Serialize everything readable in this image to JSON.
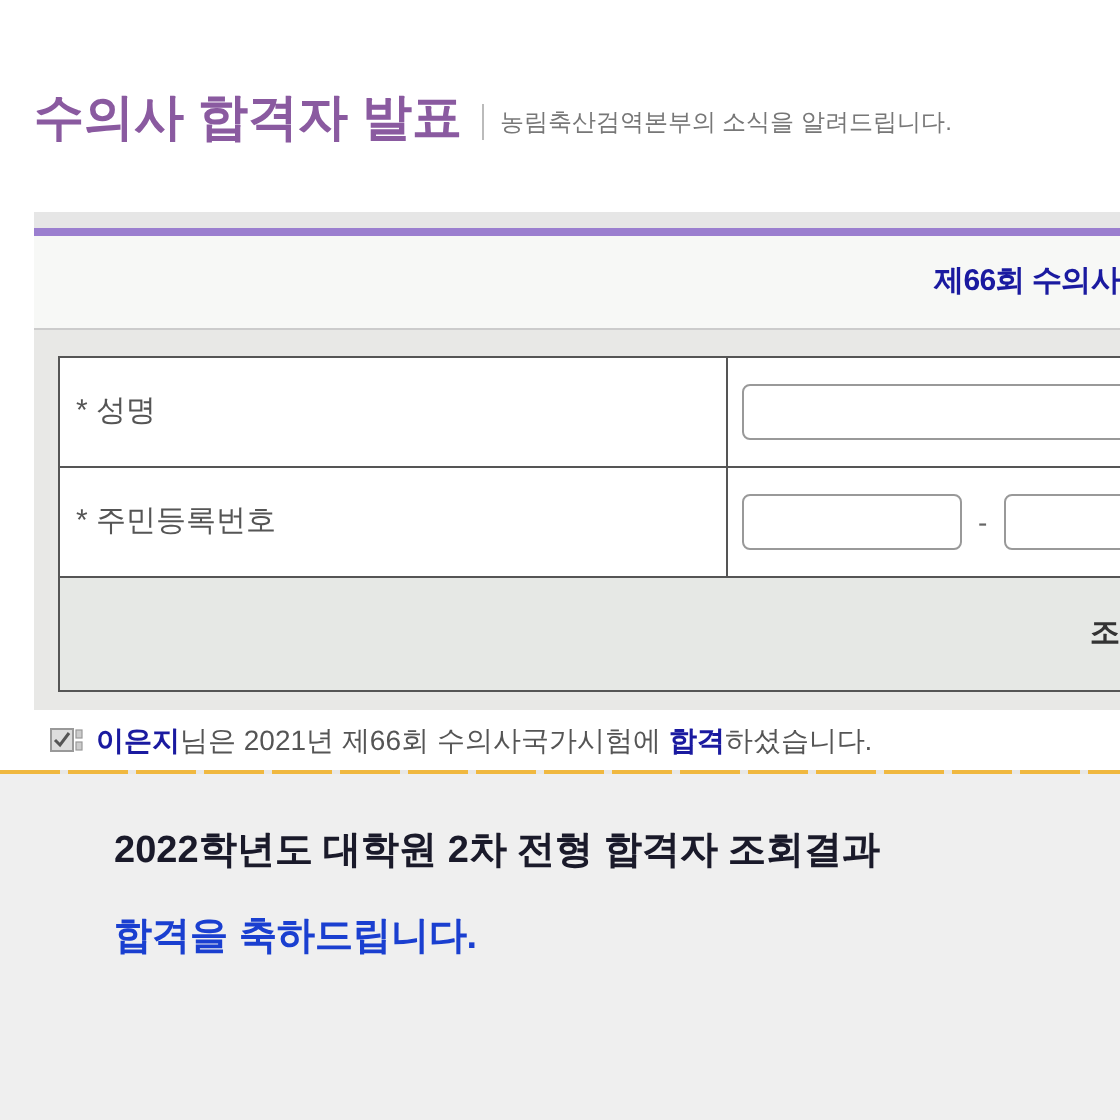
{
  "page_title": "수의사 합격자 발표",
  "page_subtitle": "농림축산검역본부의 소식을 알려드립니다.",
  "exam_heading": "제66회 수의사",
  "form": {
    "fields": [
      {
        "label": "* 성명",
        "kind": "single"
      },
      {
        "label": "* 주민등록번호",
        "kind": "split",
        "separator": "-"
      }
    ],
    "submit": "조"
  },
  "result_sentence": "**이은지**님은 2021년 제66회 수의사국가시험에 **합격**하셨습니다.",
  "caption": {
    "title": "2022학년도 대학원 2차 전형 합격자 조회결과",
    "message": "합격을 축하드립니다."
  }
}
